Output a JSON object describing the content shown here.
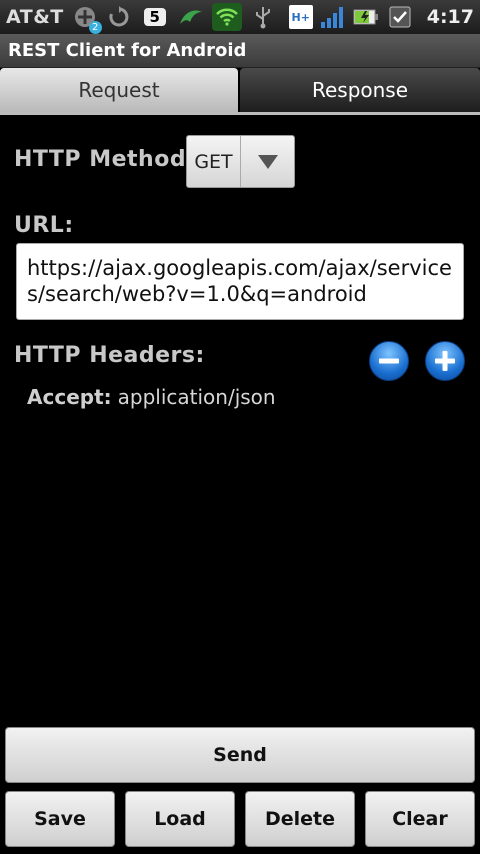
{
  "status_bar": {
    "carrier": "AT&T",
    "notification_count": "2",
    "badge_number": "5",
    "network_type": "H+",
    "time": "4:17"
  },
  "app": {
    "title": "REST Client for Android"
  },
  "tabs": [
    {
      "label": "Request",
      "active": true
    },
    {
      "label": "Response",
      "active": false
    }
  ],
  "request": {
    "method_label": "HTTP Method:",
    "method_value": "GET",
    "url_label": "URL:",
    "url_value": "https://ajax.googleapis.com/ajax/services/search/web?v=1.0&q=android",
    "headers_label": "HTTP Headers:",
    "headers": [
      {
        "key": "Accept:",
        "value": "application/json"
      }
    ]
  },
  "actions": {
    "send": "Send",
    "save": "Save",
    "load": "Load",
    "delete": "Delete",
    "clear": "Clear"
  },
  "colors": {
    "background": "#000000",
    "accent_blue": "#1a6fd0",
    "button_face": "#e6e6e6"
  }
}
